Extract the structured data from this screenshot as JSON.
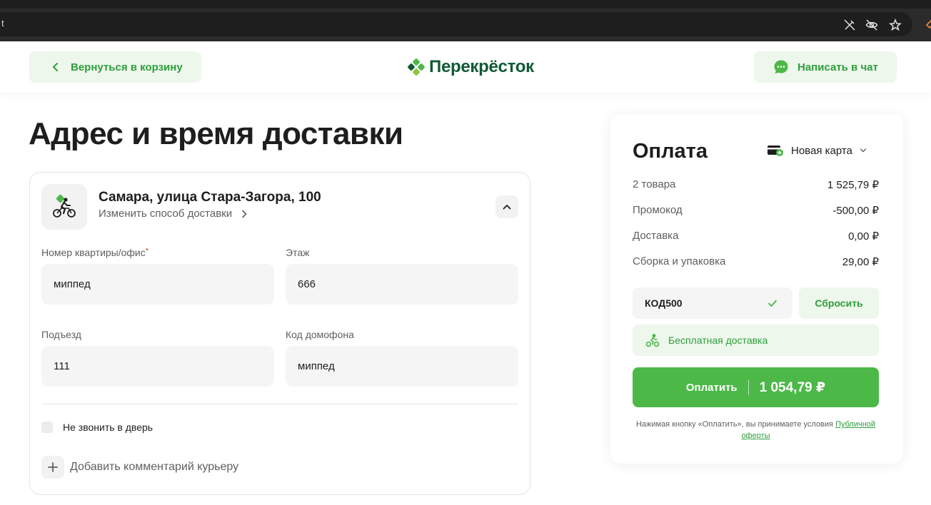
{
  "browser": {
    "url_tail": "t",
    "icons": [
      "eye-slash-pen-icon",
      "eye-off-icon",
      "star-icon"
    ]
  },
  "header": {
    "back_label": "Вернуться в корзину",
    "logo_text": "Перекрёсток",
    "chat_label": "Написать в чат"
  },
  "page": {
    "title": "Адрес и время доставки"
  },
  "address_card": {
    "address": "Самара, улица Стара-Загора, 100",
    "change_delivery": "Изменить способ доставки",
    "fields": {
      "apartment": {
        "label": "Номер квартиры/офис",
        "required_mark": "*",
        "value": "миппед"
      },
      "floor": {
        "label": "Этаж",
        "value": "666"
      },
      "entrance": {
        "label": "Подъезд",
        "value": "111"
      },
      "intercom": {
        "label": "Код домофона",
        "value": "миппед"
      }
    },
    "no_ring_label": "Не звонить в дверь",
    "add_comment_label": "Добавить комментарий курьеру"
  },
  "payment": {
    "title": "Оплата",
    "card_label": "Новая карта",
    "summary": [
      {
        "label": "2 товара",
        "value": "1 525,79 ₽"
      },
      {
        "label": "Промокод",
        "value": "-500,00 ₽"
      },
      {
        "label": "Доставка",
        "value": "0,00 ₽"
      },
      {
        "label": "Сборка и упаковка",
        "value": "29,00 ₽"
      }
    ],
    "promo_code": "КОД500",
    "reset_label": "Сбросить",
    "free_delivery_label": "Бесплатная доставка",
    "pay_label": "Оплатить",
    "pay_amount": "1 054,79 ₽",
    "terms_text": "Нажимая кнопку «Оплатить», вы принимаете условия",
    "terms_link": "Публичной оферты"
  },
  "colors": {
    "accent_green": "#4cb848",
    "text_green": "#2e9e3c",
    "logo_green": "#0f5a35",
    "light_green_bg": "#eef7ec"
  }
}
